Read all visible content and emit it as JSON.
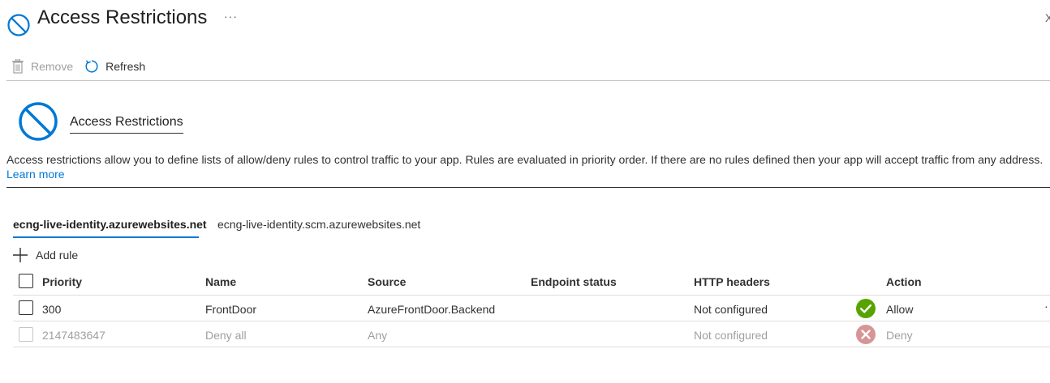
{
  "header": {
    "title": "Access Restrictions",
    "more": "···",
    "close": "X"
  },
  "toolbar": {
    "remove_label": "Remove",
    "refresh_label": "Refresh"
  },
  "section": {
    "title": "Access Restrictions",
    "description": "Access restrictions allow you to define lists of allow/deny rules to control traffic to your app. Rules are evaluated in priority order. If there are no rules defined then your app will accept traffic from any address.",
    "learn_more": "Learn more"
  },
  "tabs": [
    {
      "label": "ecng-live-identity.azurewebsites.net",
      "active": true
    },
    {
      "label": "ecng-live-identity.scm.azurewebsites.net",
      "active": false
    }
  ],
  "add_rule_label": "Add rule",
  "table": {
    "columns": [
      "Priority",
      "Name",
      "Source",
      "Endpoint status",
      "HTTP headers",
      "Action"
    ],
    "rows": [
      {
        "priority": "300",
        "name": "FrontDoor",
        "source": "AzureFrontDoor.Backend",
        "endpoint_status": "",
        "http_headers": "Not configured",
        "action": "Allow",
        "action_icon": "check-circle-icon",
        "disabled": false
      },
      {
        "priority": "2147483647",
        "name": "Deny all",
        "source": "Any",
        "endpoint_status": "",
        "http_headers": "Not configured",
        "action": "Deny",
        "action_icon": "x-circle-icon",
        "disabled": true
      }
    ],
    "row_more": "·"
  },
  "colors": {
    "accent": "#0078d4",
    "allow": "#57a300",
    "deny": "#d79595"
  }
}
